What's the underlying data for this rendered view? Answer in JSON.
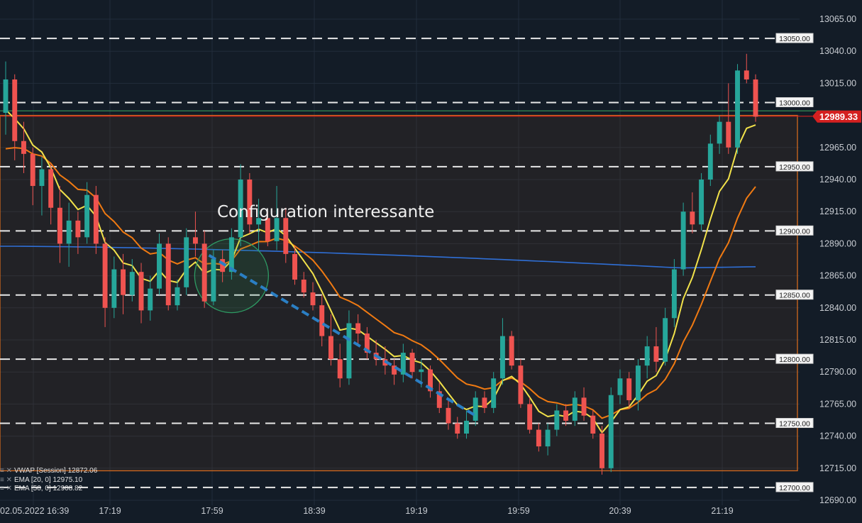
{
  "chart_data": {
    "type": "candlestick",
    "y_axis": {
      "ticks": [
        13065,
        13040,
        13015,
        12990,
        12965,
        12940,
        12915,
        12890,
        12865,
        12840,
        12815,
        12790,
        12765,
        12740,
        12715,
        12690
      ],
      "range": [
        12685,
        13075
      ],
      "position": "right"
    },
    "x_axis": {
      "ticks": [
        "02.05.2022 16:39",
        "17:19",
        "17:59",
        "18:39",
        "19:19",
        "19:59",
        "20:39",
        "21:19"
      ]
    },
    "levels": [
      {
        "value": 13050,
        "label": "13050.00"
      },
      {
        "value": 13000,
        "label": "13000.00"
      },
      {
        "value": 12950,
        "label": "12950.00"
      },
      {
        "value": 12900,
        "label": "12900.00"
      },
      {
        "value": 12850,
        "label": "12850.00"
      },
      {
        "value": 12800,
        "label": "12800.00"
      },
      {
        "value": 12750,
        "label": "12750.00"
      },
      {
        "value": 12700,
        "label": "12700.00"
      }
    ],
    "last_price": {
      "value": 12989.33,
      "label": "12989.33",
      "color": "#d42020"
    },
    "upper_line": 12993,
    "range_box": {
      "high": 12990,
      "low": 12713,
      "color": "#d2691e"
    },
    "indicators": [
      {
        "key": "vwap",
        "legend": "VWAP [Session] 12872.06",
        "color": "#2f6fd6",
        "last": 12872.06
      },
      {
        "key": "ema20",
        "legend": "EMA [20, 0] 12975.10",
        "color": "#f2e24a",
        "last": 12975.1
      },
      {
        "key": "ema50",
        "legend": "EMA [50, 0] 12908.82",
        "color": "#f07a12",
        "last": 12908.82
      }
    ],
    "annotation": "Configuration interessante",
    "trendline": {
      "from": [
        22.5,
        12881
      ],
      "to": [
        52,
        12756
      ]
    },
    "circle": {
      "center": [
        25,
        12865
      ],
      "price_radius": 29
    },
    "candles": [
      [
        12992,
        13032,
        12975,
        13018
      ],
      [
        13018,
        13022,
        12955,
        12970
      ],
      [
        12970,
        12985,
        12945,
        12960
      ],
      [
        12960,
        12965,
        12920,
        12935
      ],
      [
        12935,
        12958,
        12912,
        12948
      ],
      [
        12948,
        12952,
        12905,
        12918
      ],
      [
        12918,
        12935,
        12875,
        12890
      ],
      [
        12890,
        12922,
        12872,
        12908
      ],
      [
        12908,
        12915,
        12882,
        12895
      ],
      [
        12895,
        12938,
        12890,
        12928
      ],
      [
        12928,
        12935,
        12882,
        12890
      ],
      [
        12890,
        12895,
        12825,
        12840
      ],
      [
        12840,
        12880,
        12832,
        12870
      ],
      [
        12870,
        12882,
        12835,
        12850
      ],
      [
        12850,
        12878,
        12845,
        12868
      ],
      [
        12868,
        12875,
        12828,
        12838
      ],
      [
        12838,
        12865,
        12830,
        12855
      ],
      [
        12855,
        12898,
        12850,
        12890
      ],
      [
        12890,
        12895,
        12838,
        12842
      ],
      [
        12842,
        12862,
        12838,
        12856
      ],
      [
        12856,
        12902,
        12850,
        12895
      ],
      [
        12895,
        12915,
        12880,
        12890
      ],
      [
        12890,
        12900,
        12840,
        12845
      ],
      [
        12845,
        12885,
        12842,
        12878
      ],
      [
        12878,
        12885,
        12860,
        12868
      ],
      [
        12868,
        12902,
        12862,
        12895
      ],
      [
        12895,
        12952,
        12888,
        12940
      ],
      [
        12940,
        12945,
        12898,
        12905
      ],
      [
        12905,
        12925,
        12885,
        12910
      ],
      [
        12910,
        12915,
        12888,
        12892
      ],
      [
        12892,
        12935,
        12885,
        12910
      ],
      [
        12910,
        12918,
        12875,
        12882
      ],
      [
        12882,
        12888,
        12858,
        12862
      ],
      [
        12862,
        12868,
        12848,
        12852
      ],
      [
        12852,
        12860,
        12838,
        12842
      ],
      [
        12842,
        12850,
        12810,
        12818
      ],
      [
        12818,
        12835,
        12795,
        12800
      ],
      [
        12800,
        12812,
        12778,
        12785
      ],
      [
        12785,
        12838,
        12780,
        12828
      ],
      [
        12828,
        12835,
        12812,
        12820
      ],
      [
        12820,
        12825,
        12800,
        12805
      ],
      [
        12805,
        12815,
        12795,
        12800
      ],
      [
        12800,
        12810,
        12788,
        12795
      ],
      [
        12795,
        12800,
        12780,
        12788
      ],
      [
        12788,
        12812,
        12782,
        12805
      ],
      [
        12805,
        12808,
        12785,
        12790
      ],
      [
        12790,
        12800,
        12778,
        12792
      ],
      [
        12792,
        12795,
        12770,
        12775
      ],
      [
        12775,
        12782,
        12758,
        12762
      ],
      [
        12762,
        12768,
        12745,
        12750
      ],
      [
        12750,
        12755,
        12738,
        12742
      ],
      [
        12742,
        12760,
        12738,
        12752
      ],
      [
        12752,
        12775,
        12748,
        12770
      ],
      [
        12770,
        12775,
        12758,
        12762
      ],
      [
        12762,
        12790,
        12758,
        12785
      ],
      [
        12785,
        12832,
        12780,
        12818
      ],
      [
        12818,
        12822,
        12792,
        12795
      ],
      [
        12795,
        12800,
        12762,
        12765
      ],
      [
        12765,
        12770,
        12742,
        12745
      ],
      [
        12745,
        12750,
        12728,
        12732
      ],
      [
        12732,
        12750,
        12725,
        12745
      ],
      [
        12745,
        12765,
        12740,
        12760
      ],
      [
        12760,
        12765,
        12748,
        12752
      ],
      [
        12752,
        12775,
        12748,
        12770
      ],
      [
        12770,
        12778,
        12752,
        12756
      ],
      [
        12756,
        12760,
        12738,
        12742
      ],
      [
        12742,
        12748,
        12710,
        12715
      ],
      [
        12715,
        12778,
        12712,
        12772
      ],
      [
        12772,
        12792,
        12765,
        12785
      ],
      [
        12785,
        12790,
        12762,
        12768
      ],
      [
        12768,
        12800,
        12760,
        12795
      ],
      [
        12795,
        12818,
        12785,
        12810
      ],
      [
        12810,
        12825,
        12790,
        12798
      ],
      [
        12798,
        12840,
        12795,
        12832
      ],
      [
        12832,
        12878,
        12825,
        12870
      ],
      [
        12870,
        12922,
        12865,
        12915
      ],
      [
        12915,
        12930,
        12898,
        12905
      ],
      [
        12905,
        12945,
        12900,
        12940
      ],
      [
        12940,
        12975,
        12935,
        12968
      ],
      [
        12968,
        12990,
        12960,
        12985
      ],
      [
        12985,
        13015,
        12960,
        12965
      ],
      [
        12965,
        13030,
        12960,
        13025
      ],
      [
        13025,
        13038,
        13015,
        13018
      ],
      [
        13018,
        13022,
        12985,
        12989
      ]
    ]
  }
}
